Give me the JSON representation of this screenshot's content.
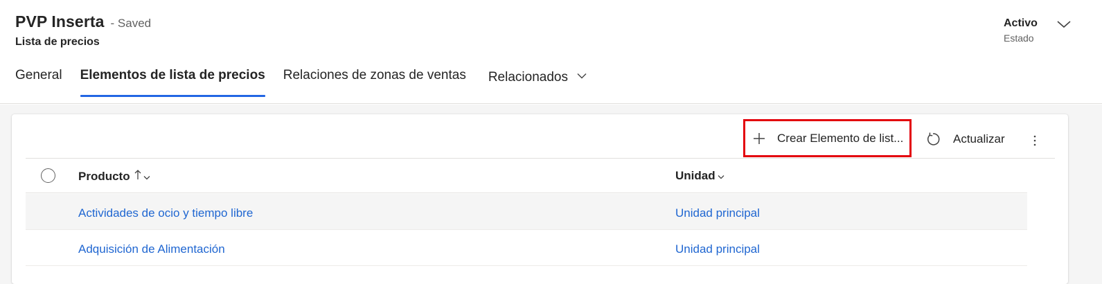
{
  "header": {
    "title": "PVP Inserta",
    "saved_status": "- Saved",
    "entity_name": "Lista de precios",
    "status_value": "Activo",
    "status_label": "Estado"
  },
  "tabs": [
    {
      "label": "General",
      "active": false
    },
    {
      "label": "Elementos de lista de precios",
      "active": true
    },
    {
      "label": "Relaciones de zonas de ventas",
      "active": false
    },
    {
      "label": "Relacionados",
      "active": false,
      "has_dropdown": true
    }
  ],
  "commands": {
    "create_label": "Crear Elemento de list...",
    "refresh_label": "Actualizar"
  },
  "grid": {
    "columns": [
      {
        "label": "Producto",
        "sort": "ascending"
      },
      {
        "label": "Unidad"
      }
    ],
    "rows": [
      {
        "producto": "Actividades de ocio y tiempo libre",
        "unidad": "Unidad principal"
      },
      {
        "producto": "Adquisición de Alimentación",
        "unidad": "Unidad principal"
      }
    ]
  },
  "icons": {
    "status_toggle": "chevron-down-icon",
    "create": "plus-icon",
    "refresh": "refresh-icon",
    "more": "more-vertical-icon",
    "select_all": "circle-checkbox-icon"
  },
  "colors": {
    "accent": "#2266e3",
    "link": "#1f66d1",
    "highlight_border": "#e3000b"
  }
}
